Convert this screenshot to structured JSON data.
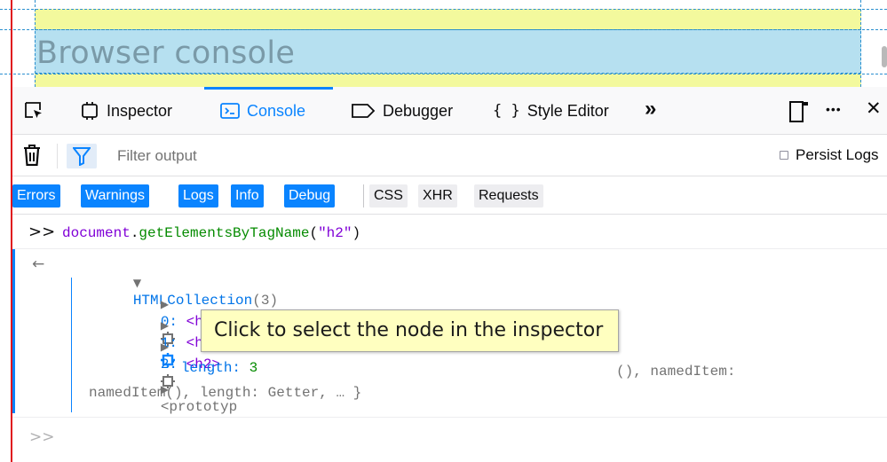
{
  "page": {
    "heading": "Browser console"
  },
  "toolbox": {
    "tabs": [
      {
        "label": "Inspector",
        "icon": "inspector-icon"
      },
      {
        "label": "Console",
        "icon": "console-icon",
        "selected": true
      },
      {
        "label": "Debugger",
        "icon": "debugger-icon"
      },
      {
        "label": "Style Editor",
        "icon": "style-editor-icon",
        "prefix": "{ }"
      }
    ],
    "overflow_glyph": "»",
    "meatball_glyph": "•••",
    "close_glyph": "✕"
  },
  "filter": {
    "placeholder": "Filter output",
    "persist_label": "Persist Logs"
  },
  "levels": {
    "on": [
      "Errors",
      "Warnings",
      "Logs",
      "Info",
      "Debug"
    ],
    "off": [
      "CSS",
      "XHR",
      "Requests"
    ]
  },
  "console": {
    "command": {
      "prompt": ">>",
      "object": "document",
      "dot": ".",
      "method": "getElementsByTagName",
      "open": "(",
      "arg": "\"h2\"",
      "close": ")"
    },
    "result": {
      "arrow": "←",
      "collection": "HTMLCollection",
      "count": "(3)",
      "items": [
        {
          "key": "0:",
          "value": "<h2>"
        },
        {
          "key": "1:",
          "value": "<h2>"
        },
        {
          "key": "2:",
          "value": "<h2>"
        }
      ],
      "length_label": "length:",
      "length_value": "3",
      "prototype_line1_start": "<prototyp",
      "prototype_line1_end": "(), namedItem:",
      "prototype_line2": "namedItem(), length: Getter, … }"
    },
    "input_prompt": ">>"
  },
  "tooltip": {
    "text": "Click to select the node in the inspector"
  },
  "colors": {
    "accent": "#0a84ff",
    "highlight_yellow": "#f3f99d",
    "highlight_blue": "#b6e0f0",
    "tooltip_bg": "#ffffc0"
  }
}
